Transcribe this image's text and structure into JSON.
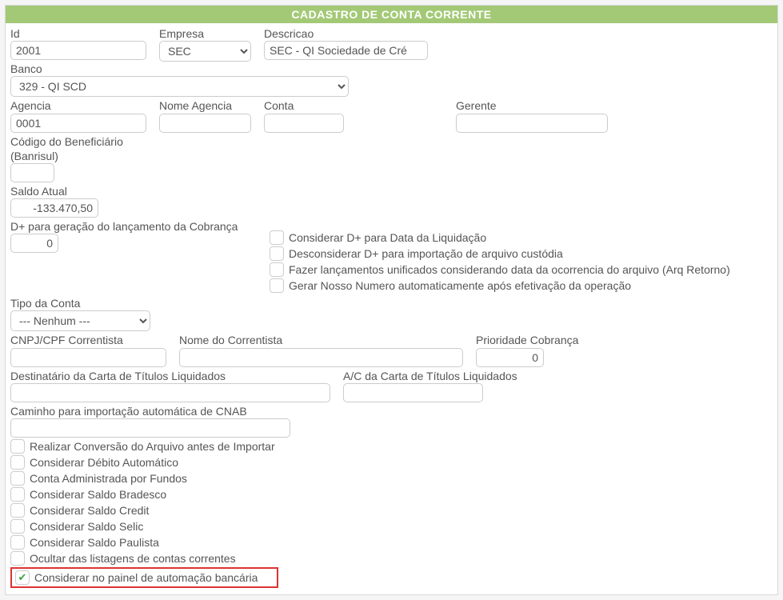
{
  "header": {
    "title": "CADASTRO DE CONTA CORRENTE"
  },
  "fields": {
    "id": {
      "label": "Id",
      "value": "2001"
    },
    "empresa": {
      "label": "Empresa",
      "value": "SEC"
    },
    "descricao": {
      "label": "Descricao",
      "value": "SEC - QI Sociedade de Cré"
    },
    "banco": {
      "label": "Banco",
      "value": "329 - QI SCD"
    },
    "agencia": {
      "label": "Agencia",
      "value": "0001"
    },
    "nomeAgencia": {
      "label": "Nome Agencia",
      "value": ""
    },
    "conta": {
      "label": "Conta",
      "value": ""
    },
    "gerente": {
      "label": "Gerente",
      "value": ""
    },
    "codigoBenef": {
      "label": "Código do Beneficiário (Banrisul)",
      "value": ""
    },
    "saldoAtual": {
      "label": "Saldo Atual",
      "value": "-133.470,50"
    },
    "dmais": {
      "label": "D+ para geração do lançamento da Cobrança",
      "value": "0"
    },
    "tipoConta": {
      "label": "Tipo da Conta",
      "value": "--- Nenhum ---"
    },
    "cnpjCorrentista": {
      "label": "CNPJ/CPF Correntista",
      "value": ""
    },
    "nomeCorrentista": {
      "label": "Nome do Correntista",
      "value": ""
    },
    "prioridadeCobranca": {
      "label": "Prioridade Cobrança",
      "value": "0"
    },
    "destinatarioCarta": {
      "label": "Destinatário da Carta de Títulos Liquidados",
      "value": ""
    },
    "acCarta": {
      "label": "A/C da Carta de Títulos Liquidados",
      "value": ""
    },
    "caminhoCnab": {
      "label": "Caminho para importação automática de CNAB",
      "value": ""
    }
  },
  "sideChecks": {
    "considerarDmaisLiquidacao": "Considerar D+ para Data da Liquidação",
    "desconsiderarDmaisCustodia": "Desconsiderar D+ para importação de arquivo custódia",
    "lancamentosUnificados": "Fazer lançamentos unificados considerando data da ocorrencia do arquivo (Arq Retorno)",
    "gerarNossoNumero": "Gerar Nosso Numero automaticamente após efetivação da operação"
  },
  "bottomChecks": {
    "realizarConversao": "Realizar Conversão do Arquivo antes de Importar",
    "debitoAutomatico": "Considerar Débito Automático",
    "contaFundos": "Conta Administrada por Fundos",
    "saldoBradesco": "Considerar Saldo Bradesco",
    "saldoCredit": "Considerar Saldo Credit",
    "saldoSelic": "Considerar Saldo Selic",
    "saldoPaulista": "Considerar Saldo Paulista",
    "ocultarListagens": "Ocultar das listagens de contas correntes",
    "painelAutomacao": "Considerar no painel de automação bancária"
  }
}
